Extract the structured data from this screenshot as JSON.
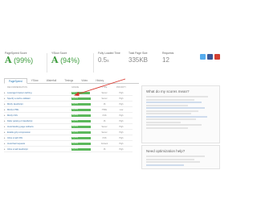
{
  "summary": {
    "pagespeed": {
      "label": "PageSpeed Score",
      "grade": "A",
      "value": "(99%)"
    },
    "yslow": {
      "label": "YSlow Score",
      "grade": "A",
      "value": "(94%)"
    },
    "load_time": {
      "label": "Fully Loaded Time",
      "value": "0.5",
      "unit": "s"
    },
    "page_size": {
      "label": "Total Page Size",
      "value": "335KB"
    },
    "requests": {
      "label": "Requests",
      "value": "12"
    }
  },
  "social": [
    "twitter-icon",
    "facebook-icon",
    "google-plus-icon"
  ],
  "colors": {
    "grade_green": "#3d9c3d",
    "bar_green": "#5cb85c",
    "link_blue": "#3a73a8",
    "arrow_red": "#d9342b"
  },
  "tabs": [
    "PageSpeed",
    "YSlow",
    "Waterfall",
    "Timings",
    "Video",
    "History"
  ],
  "rec_table": {
    "header": {
      "name": "RECOMMENDATION",
      "grade": "GRADE",
      "type": "TYPE",
      "priority": "PRIORITY"
    },
    "rows": [
      {
        "name": "Leverage browser caching",
        "grade": "A (97)",
        "type": "Server",
        "priority": "High",
        "fill": 0.97
      },
      {
        "name": "Specify a cache validator",
        "grade": "A (100)",
        "type": "Server",
        "priority": "High",
        "fill": 1.0
      },
      {
        "name": "Minify JavaScript",
        "grade": "A (100)",
        "type": "JS",
        "priority": "High",
        "fill": 1.0
      },
      {
        "name": "Minify HTML",
        "grade": "A (100)",
        "type": "HTML",
        "priority": "Low",
        "fill": 1.0
      },
      {
        "name": "Minify CSS",
        "grade": "A (100)",
        "type": "CSS",
        "priority": "High",
        "fill": 1.0
      },
      {
        "name": "Defer parsing of JavaScript",
        "grade": "A (100)",
        "type": "JS",
        "priority": "High",
        "fill": 1.0
      },
      {
        "name": "Avoid landing page redirects",
        "grade": "A (100)",
        "type": "Server",
        "priority": "High",
        "fill": 1.0
      },
      {
        "name": "Enable gzip compression",
        "grade": "A (100)",
        "type": "Server",
        "priority": "High",
        "fill": 1.0
      },
      {
        "name": "Inline small CSS",
        "grade": "A (100)",
        "type": "CSS",
        "priority": "High",
        "fill": 1.0
      },
      {
        "name": "Avoid bad requests",
        "grade": "A (100)",
        "type": "Content",
        "priority": "High",
        "fill": 1.0
      },
      {
        "name": "Inline small JavaScript",
        "grade": "A (100)",
        "type": "JS",
        "priority": "High",
        "fill": 1.0
      }
    ]
  },
  "side_scores": {
    "title": "What do my scores mean?"
  },
  "side_help": {
    "title": "Need optimization help?"
  }
}
